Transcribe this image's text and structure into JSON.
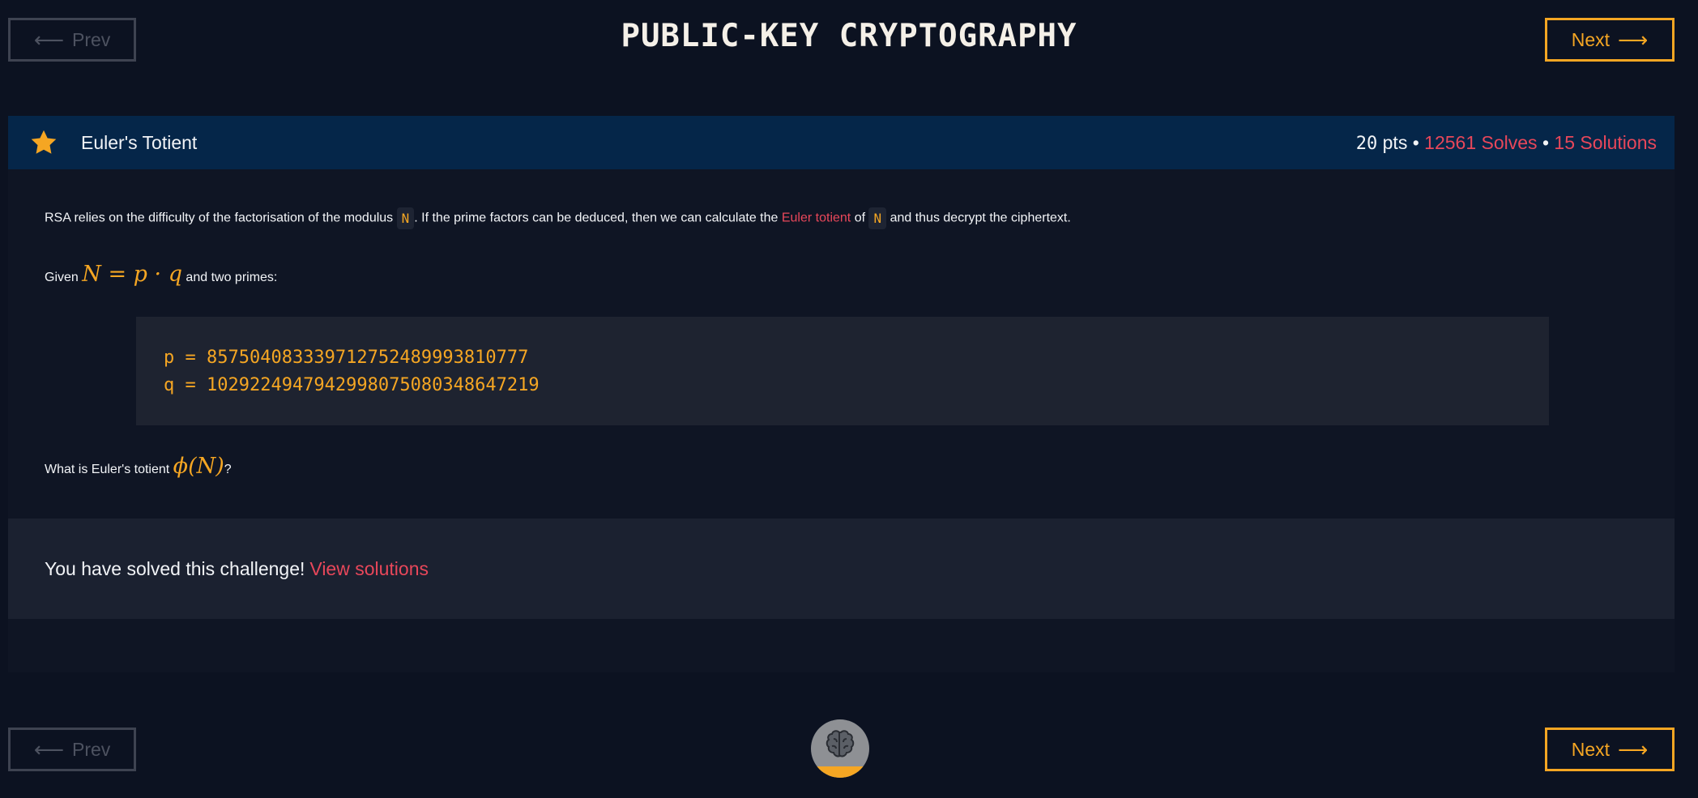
{
  "nav": {
    "prev_label": "Prev",
    "next_label": "Next",
    "prev_arrow": "⟵",
    "next_arrow": "⟶"
  },
  "page": {
    "title": "PUBLIC-KEY CRYPTOGRAPHY"
  },
  "challenge": {
    "icon": "star-icon",
    "name": "Euler's Totient",
    "points": "20",
    "pts_suffix": " pts",
    "sep1": " • ",
    "solves": "12561 Solves",
    "sep2": " • ",
    "solutions": "15 Solutions",
    "description": {
      "p1_a": "RSA relies on the difficulty of the factorisation of the modulus ",
      "p1_code1": "N",
      "p1_b": ". If the prime factors can be deduced, then we can calculate the ",
      "p1_link": "Euler totient",
      "p1_c": " of ",
      "p1_code2": "N",
      "p1_d": " and thus decrypt the ciphertext.",
      "p2_a": "Given ",
      "p2_math": "N = p · q",
      "p2_b": " and two primes:",
      "code_p": "p = 857504083339712752489993810777",
      "code_q": "q = 1029224947942998075080348647219",
      "p3_a": "What is Euler's totient ",
      "p3_math": "ϕ(N)",
      "p3_b": "?"
    },
    "solved_text": "You have solved this challenge!",
    "view_solutions": "View solutions"
  },
  "colors": {
    "background": "#0c1221",
    "accent": "#f5a623",
    "link": "#e8475a",
    "header": "#052649"
  },
  "footer": {
    "progress_icon": "brain-icon"
  }
}
